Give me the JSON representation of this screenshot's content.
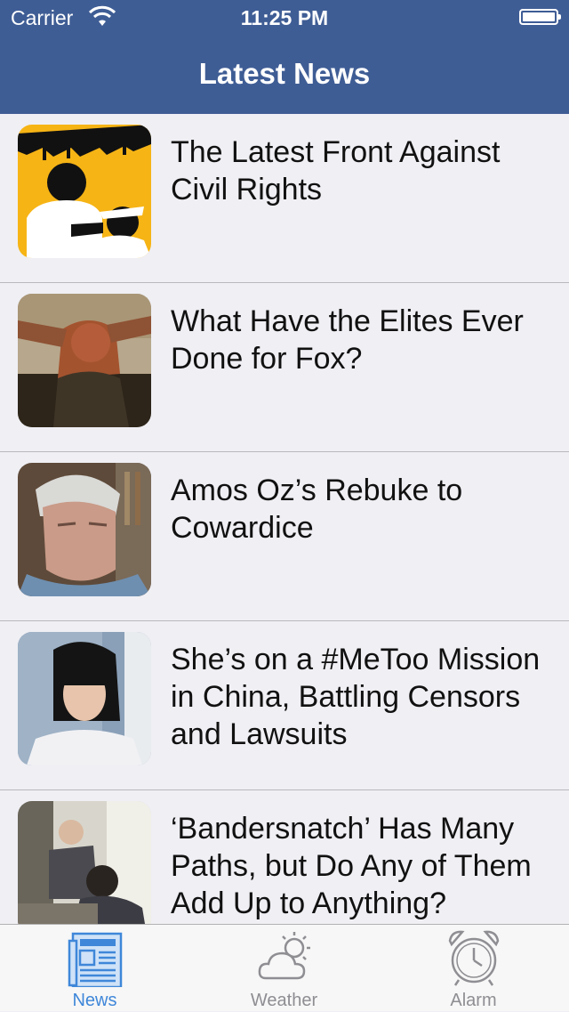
{
  "status_bar": {
    "carrier": "Carrier",
    "time": "11:25 PM"
  },
  "nav": {
    "title": "Latest News"
  },
  "articles": [
    {
      "title": "The Latest Front Against Civil Rights"
    },
    {
      "title": "What Have the Elites Ever Done for Fox?"
    },
    {
      "title": "Amos Oz’s Rebuke to Cowardice"
    },
    {
      "title": "She’s on a #MeToo Mission in China, Battling Censors and Lawsuits"
    },
    {
      "title": "‘Bandersnatch’ Has Many Paths, but Do Any of Them Add Up to Anything?"
    }
  ],
  "tabbar": {
    "tabs": [
      {
        "label": "News",
        "icon": "newspaper-icon",
        "selected": true
      },
      {
        "label": "Weather",
        "icon": "weather-icon",
        "selected": false
      },
      {
        "label": "Alarm",
        "icon": "alarm-clock-icon",
        "selected": false
      }
    ]
  },
  "colors": {
    "nav_bar": "#3f5d95",
    "tab_active": "#3f87d9",
    "tab_inactive": "#8e8e93"
  }
}
